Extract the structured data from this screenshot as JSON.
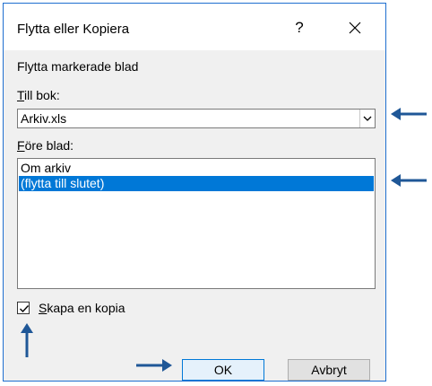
{
  "dialog": {
    "title": "Flytta eller Kopiera",
    "help_glyph": "?",
    "heading": "Flytta markerade blad",
    "to_book": {
      "label_accel": "T",
      "label_rest": "ill bok:",
      "value": "Arkiv.xls"
    },
    "before_sheet": {
      "label_accel": "F",
      "label_rest": "öre blad:",
      "items": [
        "Om arkiv",
        "(flytta till slutet)"
      ],
      "selected_index": 1
    },
    "create_copy": {
      "label_accel": "S",
      "label_rest": "kapa en kopia",
      "checked": true
    },
    "ok_label": "OK",
    "cancel_label": "Avbryt"
  },
  "colors": {
    "border": "#1e6fd0",
    "selection": "#0078d7",
    "annotation_arrow": "#1f5797"
  }
}
